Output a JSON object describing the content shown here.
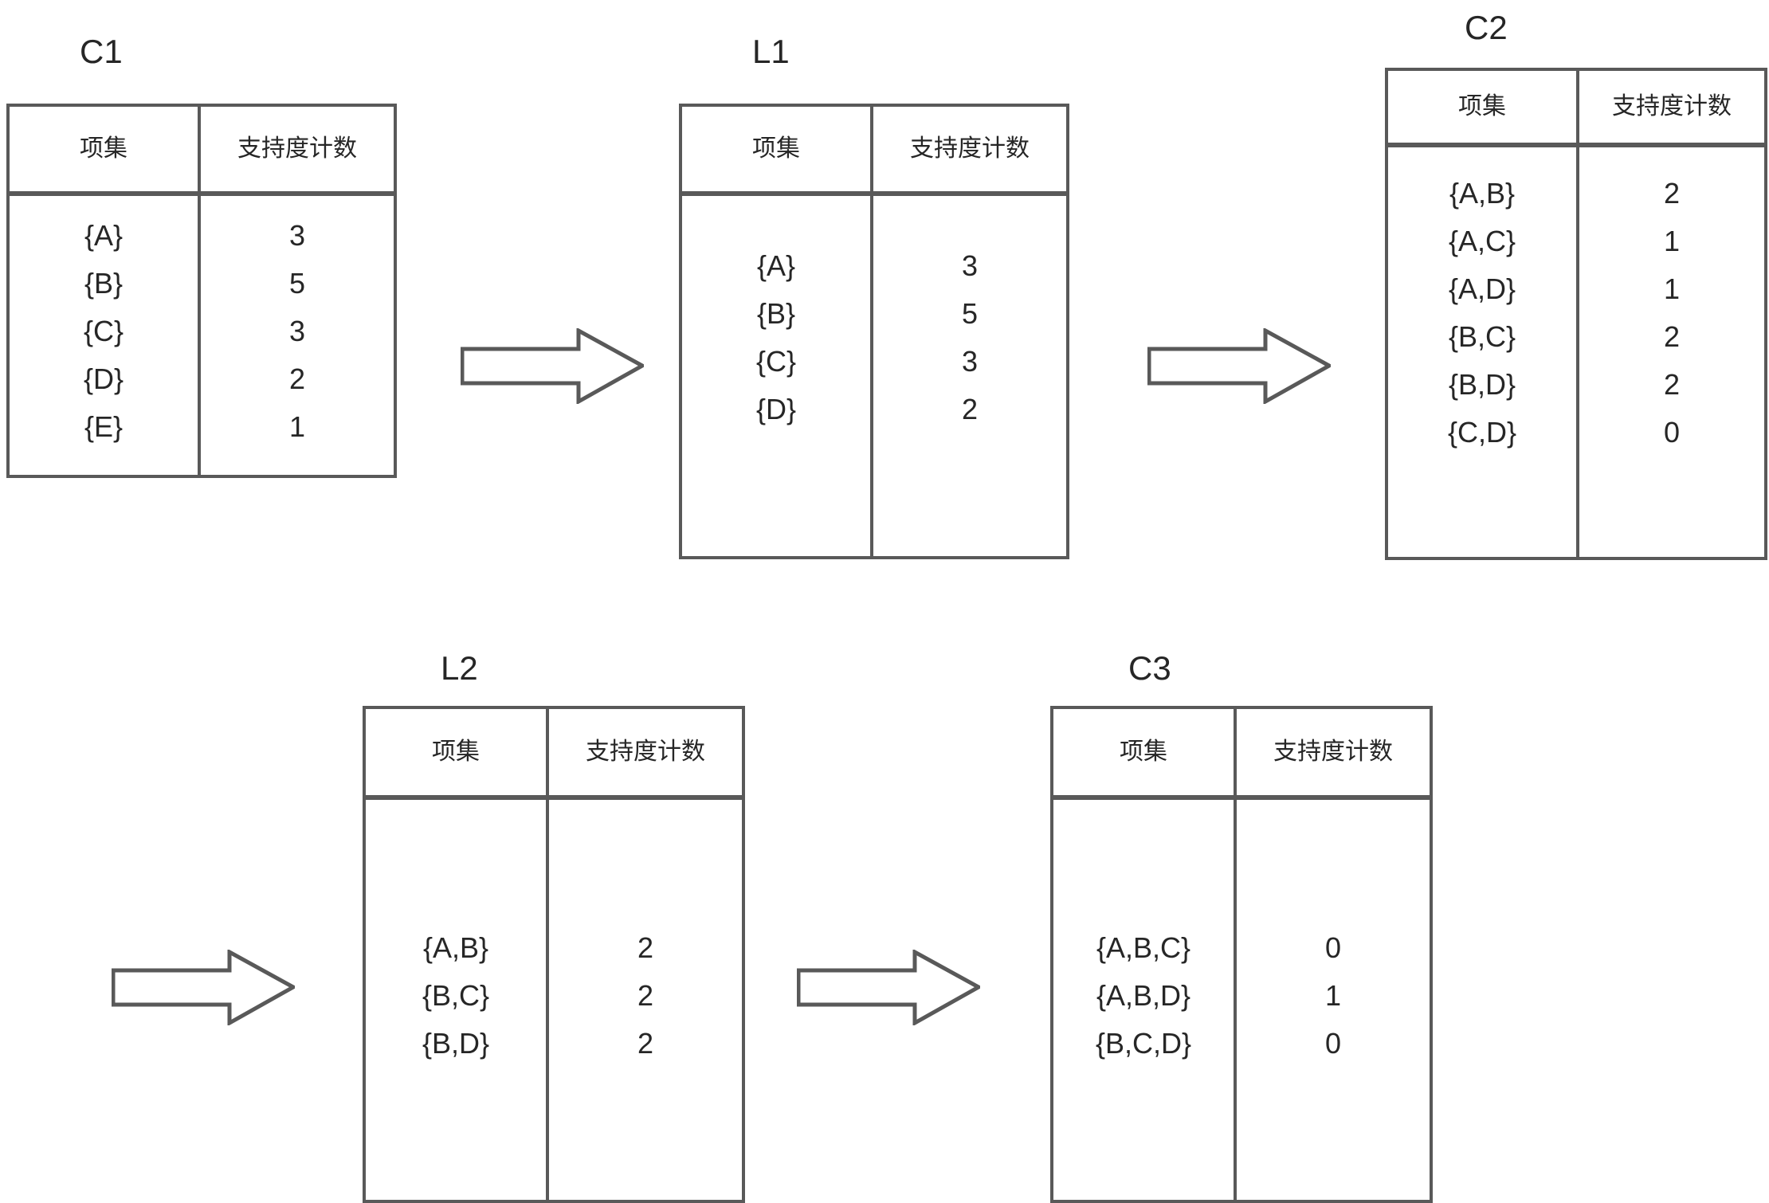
{
  "diagram": {
    "title_hidden": "Apriori candidate and frequent itemset generation",
    "columns": {
      "itemset": "项集",
      "support_count": "支持度计数"
    },
    "stroke_color": "#595959",
    "text_color": "#262626"
  },
  "tables": {
    "c1": {
      "label": "C1",
      "headers": {
        "itemset": "项集",
        "support_count": "支持度计数"
      },
      "rows": [
        {
          "itemset": "{A}",
          "count": "3"
        },
        {
          "itemset": "{B}",
          "count": "5"
        },
        {
          "itemset": "{C}",
          "count": "3"
        },
        {
          "itemset": "{D}",
          "count": "2"
        },
        {
          "itemset": "{E}",
          "count": "1"
        }
      ]
    },
    "l1": {
      "label": "L1",
      "headers": {
        "itemset": "项集",
        "support_count": "支持度计数"
      },
      "rows": [
        {
          "itemset": "{A}",
          "count": "3"
        },
        {
          "itemset": "{B}",
          "count": "5"
        },
        {
          "itemset": "{C}",
          "count": "3"
        },
        {
          "itemset": "{D}",
          "count": "2"
        }
      ]
    },
    "c2": {
      "label": "C2",
      "headers": {
        "itemset": "项集",
        "support_count": "支持度计数"
      },
      "rows": [
        {
          "itemset": "{A,B}",
          "count": "2"
        },
        {
          "itemset": "{A,C}",
          "count": "1"
        },
        {
          "itemset": "{A,D}",
          "count": "1"
        },
        {
          "itemset": "{B,C}",
          "count": "2"
        },
        {
          "itemset": "{B,D}",
          "count": "2"
        },
        {
          "itemset": "{C,D}",
          "count": "0"
        }
      ]
    },
    "l2": {
      "label": "L2",
      "headers": {
        "itemset": "项集",
        "support_count": "支持度计数"
      },
      "rows": [
        {
          "itemset": "{A,B}",
          "count": "2"
        },
        {
          "itemset": "{B,C}",
          "count": "2"
        },
        {
          "itemset": "{B,D}",
          "count": "2"
        }
      ]
    },
    "c3": {
      "label": "C3",
      "headers": {
        "itemset": "项集",
        "support_count": "支持度计数"
      },
      "rows": [
        {
          "itemset": "{A,B,C}",
          "count": "0"
        },
        {
          "itemset": "{A,B,D}",
          "count": "1"
        },
        {
          "itemset": "{B,C,D}",
          "count": "0"
        }
      ]
    }
  },
  "arrows": [
    {
      "name": "arrow-c1-to-l1",
      "direction": "right"
    },
    {
      "name": "arrow-l1-to-c2",
      "direction": "right"
    },
    {
      "name": "arrow-c2-to-l2",
      "direction": "right"
    },
    {
      "name": "arrow-l2-to-c3",
      "direction": "right"
    }
  ]
}
